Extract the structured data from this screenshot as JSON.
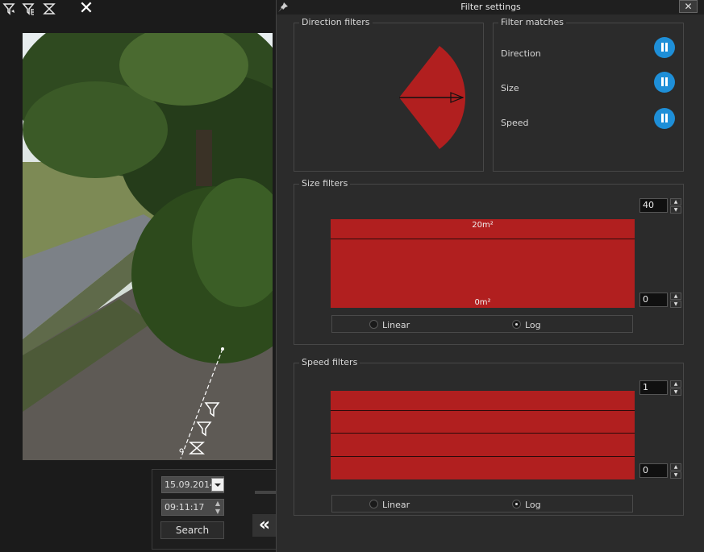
{
  "toolbar": {
    "icons": [
      "filter-direction-icon",
      "filter-size-icon",
      "filter-speed-icon"
    ],
    "close_icon": "close-icon"
  },
  "controls": {
    "date": "15.09.2014",
    "time": "09:11:17",
    "search_label": "Search"
  },
  "dialog": {
    "title": "Filter settings",
    "direction": {
      "label": "Direction filters",
      "color": "#b11f1f"
    },
    "matches": {
      "label": "Filter matches",
      "items": [
        {
          "label": "Direction"
        },
        {
          "label": "Size"
        },
        {
          "label": "Speed"
        }
      ],
      "button_color": "#1e8fd8"
    },
    "size": {
      "label": "Size filters",
      "max_value": "40",
      "min_value": "0",
      "top_label": "20m²",
      "bottom_label": "0m²",
      "scale_options": [
        "Linear",
        "Log"
      ],
      "selected": "Log"
    },
    "speed": {
      "label": "Speed filters",
      "max_value": "1",
      "min_value": "0",
      "scale_options": [
        "Linear",
        "Log"
      ],
      "selected": "Log"
    }
  }
}
